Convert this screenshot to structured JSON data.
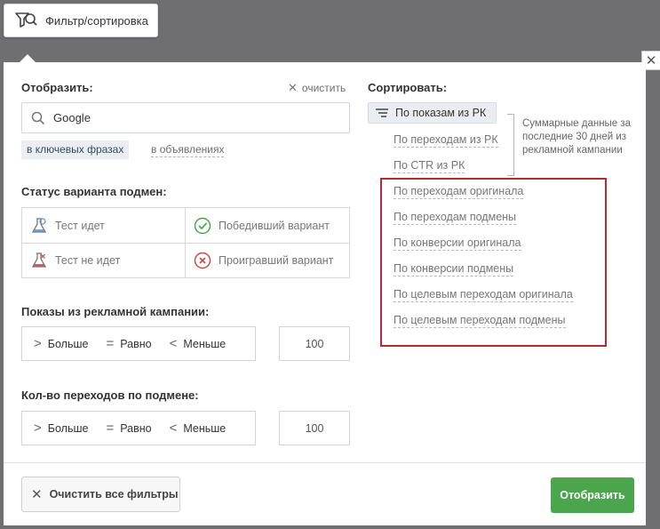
{
  "topbar": {
    "filter_button_label": "Фильтр/сортировка"
  },
  "display": {
    "heading": "Отобразить:",
    "clear_label": "очистить",
    "search_value": "Google",
    "scope_selected": "в ключевых фразах",
    "scope_other": "в объявлениях"
  },
  "status": {
    "heading": "Статус варианта подмен:",
    "options": [
      {
        "label": "Тест идет",
        "icon": "flask-icon"
      },
      {
        "label": "Победивший вариант",
        "icon": "check-circle-icon"
      },
      {
        "label": "Тест не идет",
        "icon": "flask-icon"
      },
      {
        "label": "Проигравший вариант",
        "icon": "x-circle-icon"
      }
    ]
  },
  "impressions": {
    "heading": "Показы из рекламной кампании:",
    "more": "Больше",
    "equal": "Равно",
    "less": "Меньше",
    "value": "100"
  },
  "clicks": {
    "heading": "Кол-во переходов по подмене:",
    "more": "Больше",
    "equal": "Равно",
    "less": "Меньше",
    "value": "100"
  },
  "sort": {
    "heading": "Сортировать:",
    "active": "По показам из РК",
    "campaign_items": [
      "По переходам из РК",
      "По CTR из РК"
    ],
    "summary_note": "Суммарные данные за последние 30 дней из рекламной кампании",
    "items": [
      "По переходам оригинала",
      "По переходам подмены",
      "По конверсии оригинала",
      "По конверсии подмены",
      "По целевым переходам оригинала",
      "По целевым переходам подмены"
    ]
  },
  "footer": {
    "clear_all_label": "Очистить все фильтры",
    "apply_label": "Отобразить"
  },
  "colors": {
    "accent_green": "#4aa54c",
    "highlight_red": "#b22a35"
  }
}
